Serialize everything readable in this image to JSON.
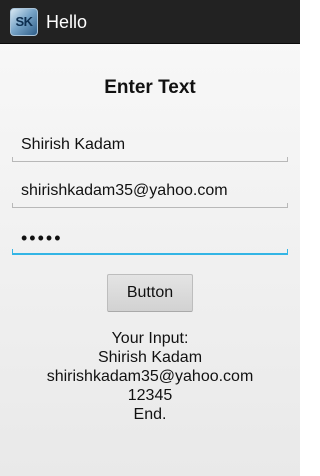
{
  "action_bar": {
    "icon_text": "SK",
    "title": "Hello"
  },
  "form": {
    "heading": "Enter Text",
    "name_value": "Shirish Kadam",
    "email_value": "shirishkadam35@yahoo.com",
    "password_value": "12345",
    "button_label": "Button"
  },
  "output": {
    "lines": [
      "Your Input:",
      "Shirish Kadam",
      "shirishkadam35@yahoo.com",
      "12345",
      "End."
    ]
  },
  "colors": {
    "action_bar_bg": "#222222",
    "focus_accent": "#33b5e5",
    "body_text": "#111111"
  }
}
